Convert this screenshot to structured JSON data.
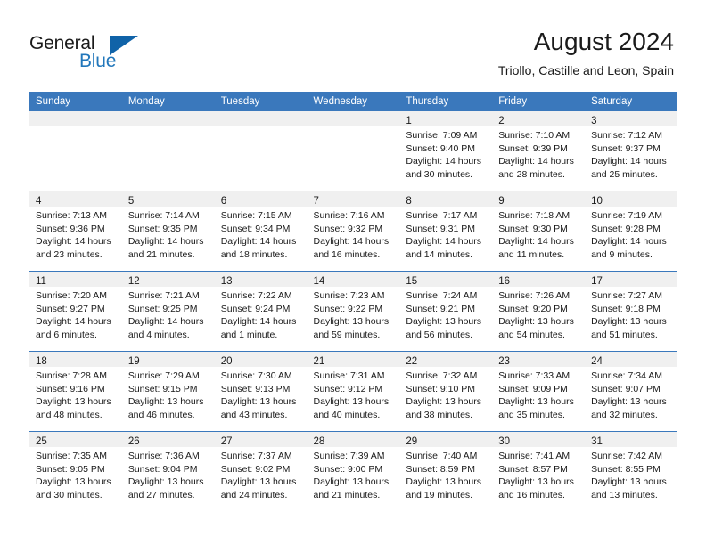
{
  "brand": {
    "name_part1": "General",
    "name_part2": "Blue"
  },
  "header": {
    "title": "August 2024",
    "subtitle": "Triollo, Castille and Leon, Spain"
  },
  "colors": {
    "header_blue": "#3a78bc",
    "band_gray": "#f0f0f0",
    "brand_blue": "#2277bb",
    "logo_triangle": "#1063a8"
  },
  "weekday_headers": [
    "Sunday",
    "Monday",
    "Tuesday",
    "Wednesday",
    "Thursday",
    "Friday",
    "Saturday"
  ],
  "weeks": [
    [
      {
        "day": "",
        "sunrise": "",
        "sunset": "",
        "daylight_line1": "",
        "daylight_line2": ""
      },
      {
        "day": "",
        "sunrise": "",
        "sunset": "",
        "daylight_line1": "",
        "daylight_line2": ""
      },
      {
        "day": "",
        "sunrise": "",
        "sunset": "",
        "daylight_line1": "",
        "daylight_line2": ""
      },
      {
        "day": "",
        "sunrise": "",
        "sunset": "",
        "daylight_line1": "",
        "daylight_line2": ""
      },
      {
        "day": "1",
        "sunrise": "Sunrise: 7:09 AM",
        "sunset": "Sunset: 9:40 PM",
        "daylight_line1": "Daylight: 14 hours",
        "daylight_line2": "and 30 minutes."
      },
      {
        "day": "2",
        "sunrise": "Sunrise: 7:10 AM",
        "sunset": "Sunset: 9:39 PM",
        "daylight_line1": "Daylight: 14 hours",
        "daylight_line2": "and 28 minutes."
      },
      {
        "day": "3",
        "sunrise": "Sunrise: 7:12 AM",
        "sunset": "Sunset: 9:37 PM",
        "daylight_line1": "Daylight: 14 hours",
        "daylight_line2": "and 25 minutes."
      }
    ],
    [
      {
        "day": "4",
        "sunrise": "Sunrise: 7:13 AM",
        "sunset": "Sunset: 9:36 PM",
        "daylight_line1": "Daylight: 14 hours",
        "daylight_line2": "and 23 minutes."
      },
      {
        "day": "5",
        "sunrise": "Sunrise: 7:14 AM",
        "sunset": "Sunset: 9:35 PM",
        "daylight_line1": "Daylight: 14 hours",
        "daylight_line2": "and 21 minutes."
      },
      {
        "day": "6",
        "sunrise": "Sunrise: 7:15 AM",
        "sunset": "Sunset: 9:34 PM",
        "daylight_line1": "Daylight: 14 hours",
        "daylight_line2": "and 18 minutes."
      },
      {
        "day": "7",
        "sunrise": "Sunrise: 7:16 AM",
        "sunset": "Sunset: 9:32 PM",
        "daylight_line1": "Daylight: 14 hours",
        "daylight_line2": "and 16 minutes."
      },
      {
        "day": "8",
        "sunrise": "Sunrise: 7:17 AM",
        "sunset": "Sunset: 9:31 PM",
        "daylight_line1": "Daylight: 14 hours",
        "daylight_line2": "and 14 minutes."
      },
      {
        "day": "9",
        "sunrise": "Sunrise: 7:18 AM",
        "sunset": "Sunset: 9:30 PM",
        "daylight_line1": "Daylight: 14 hours",
        "daylight_line2": "and 11 minutes."
      },
      {
        "day": "10",
        "sunrise": "Sunrise: 7:19 AM",
        "sunset": "Sunset: 9:28 PM",
        "daylight_line1": "Daylight: 14 hours",
        "daylight_line2": "and 9 minutes."
      }
    ],
    [
      {
        "day": "11",
        "sunrise": "Sunrise: 7:20 AM",
        "sunset": "Sunset: 9:27 PM",
        "daylight_line1": "Daylight: 14 hours",
        "daylight_line2": "and 6 minutes."
      },
      {
        "day": "12",
        "sunrise": "Sunrise: 7:21 AM",
        "sunset": "Sunset: 9:25 PM",
        "daylight_line1": "Daylight: 14 hours",
        "daylight_line2": "and 4 minutes."
      },
      {
        "day": "13",
        "sunrise": "Sunrise: 7:22 AM",
        "sunset": "Sunset: 9:24 PM",
        "daylight_line1": "Daylight: 14 hours",
        "daylight_line2": "and 1 minute."
      },
      {
        "day": "14",
        "sunrise": "Sunrise: 7:23 AM",
        "sunset": "Sunset: 9:22 PM",
        "daylight_line1": "Daylight: 13 hours",
        "daylight_line2": "and 59 minutes."
      },
      {
        "day": "15",
        "sunrise": "Sunrise: 7:24 AM",
        "sunset": "Sunset: 9:21 PM",
        "daylight_line1": "Daylight: 13 hours",
        "daylight_line2": "and 56 minutes."
      },
      {
        "day": "16",
        "sunrise": "Sunrise: 7:26 AM",
        "sunset": "Sunset: 9:20 PM",
        "daylight_line1": "Daylight: 13 hours",
        "daylight_line2": "and 54 minutes."
      },
      {
        "day": "17",
        "sunrise": "Sunrise: 7:27 AM",
        "sunset": "Sunset: 9:18 PM",
        "daylight_line1": "Daylight: 13 hours",
        "daylight_line2": "and 51 minutes."
      }
    ],
    [
      {
        "day": "18",
        "sunrise": "Sunrise: 7:28 AM",
        "sunset": "Sunset: 9:16 PM",
        "daylight_line1": "Daylight: 13 hours",
        "daylight_line2": "and 48 minutes."
      },
      {
        "day": "19",
        "sunrise": "Sunrise: 7:29 AM",
        "sunset": "Sunset: 9:15 PM",
        "daylight_line1": "Daylight: 13 hours",
        "daylight_line2": "and 46 minutes."
      },
      {
        "day": "20",
        "sunrise": "Sunrise: 7:30 AM",
        "sunset": "Sunset: 9:13 PM",
        "daylight_line1": "Daylight: 13 hours",
        "daylight_line2": "and 43 minutes."
      },
      {
        "day": "21",
        "sunrise": "Sunrise: 7:31 AM",
        "sunset": "Sunset: 9:12 PM",
        "daylight_line1": "Daylight: 13 hours",
        "daylight_line2": "and 40 minutes."
      },
      {
        "day": "22",
        "sunrise": "Sunrise: 7:32 AM",
        "sunset": "Sunset: 9:10 PM",
        "daylight_line1": "Daylight: 13 hours",
        "daylight_line2": "and 38 minutes."
      },
      {
        "day": "23",
        "sunrise": "Sunrise: 7:33 AM",
        "sunset": "Sunset: 9:09 PM",
        "daylight_line1": "Daylight: 13 hours",
        "daylight_line2": "and 35 minutes."
      },
      {
        "day": "24",
        "sunrise": "Sunrise: 7:34 AM",
        "sunset": "Sunset: 9:07 PM",
        "daylight_line1": "Daylight: 13 hours",
        "daylight_line2": "and 32 minutes."
      }
    ],
    [
      {
        "day": "25",
        "sunrise": "Sunrise: 7:35 AM",
        "sunset": "Sunset: 9:05 PM",
        "daylight_line1": "Daylight: 13 hours",
        "daylight_line2": "and 30 minutes."
      },
      {
        "day": "26",
        "sunrise": "Sunrise: 7:36 AM",
        "sunset": "Sunset: 9:04 PM",
        "daylight_line1": "Daylight: 13 hours",
        "daylight_line2": "and 27 minutes."
      },
      {
        "day": "27",
        "sunrise": "Sunrise: 7:37 AM",
        "sunset": "Sunset: 9:02 PM",
        "daylight_line1": "Daylight: 13 hours",
        "daylight_line2": "and 24 minutes."
      },
      {
        "day": "28",
        "sunrise": "Sunrise: 7:39 AM",
        "sunset": "Sunset: 9:00 PM",
        "daylight_line1": "Daylight: 13 hours",
        "daylight_line2": "and 21 minutes."
      },
      {
        "day": "29",
        "sunrise": "Sunrise: 7:40 AM",
        "sunset": "Sunset: 8:59 PM",
        "daylight_line1": "Daylight: 13 hours",
        "daylight_line2": "and 19 minutes."
      },
      {
        "day": "30",
        "sunrise": "Sunrise: 7:41 AM",
        "sunset": "Sunset: 8:57 PM",
        "daylight_line1": "Daylight: 13 hours",
        "daylight_line2": "and 16 minutes."
      },
      {
        "day": "31",
        "sunrise": "Sunrise: 7:42 AM",
        "sunset": "Sunset: 8:55 PM",
        "daylight_line1": "Daylight: 13 hours",
        "daylight_line2": "and 13 minutes."
      }
    ]
  ]
}
